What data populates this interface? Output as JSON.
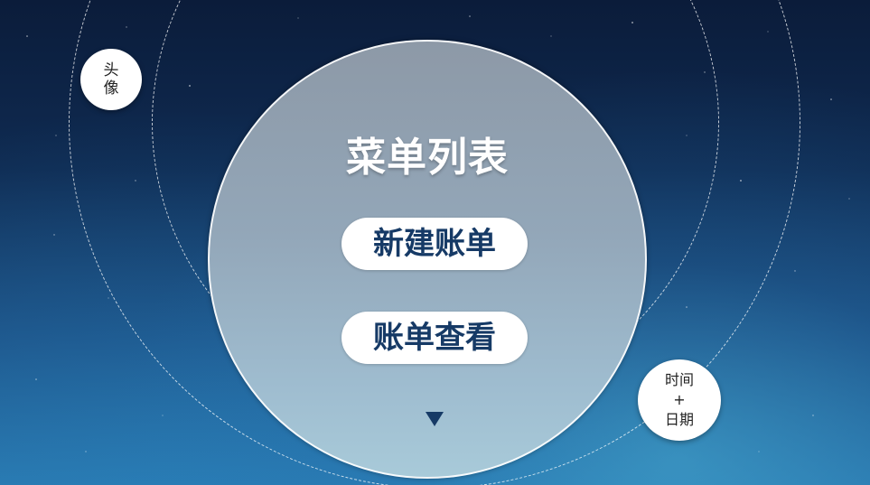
{
  "menu": {
    "title": "菜单列表",
    "new_bill_label": "新建账单",
    "view_bill_label": "账单查看",
    "more_icon": "triangle-down-icon"
  },
  "avatar": {
    "label": "头像"
  },
  "datetime": {
    "line1": "时间",
    "line2": "+",
    "line3": "日期"
  },
  "colors": {
    "accent": "#163a66",
    "circle_top": "#8d99a7",
    "circle_bottom": "#a8cad9",
    "background_top": "#0b1c3a",
    "background_bottom": "#2a78ae"
  }
}
